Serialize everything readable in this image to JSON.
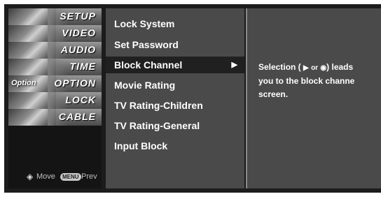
{
  "categories": [
    {
      "label": "SETUP"
    },
    {
      "label": "VIDEO"
    },
    {
      "label": "AUDIO"
    },
    {
      "label": "TIME"
    },
    {
      "label": "OPTION",
      "overlay": "Option"
    },
    {
      "label": "LOCK"
    },
    {
      "label": "CABLE"
    }
  ],
  "hint": {
    "move_label": "Move",
    "menu_key": "MENU",
    "prev_label": "Prev"
  },
  "menu": {
    "items": [
      {
        "label": "Lock System"
      },
      {
        "label": "Set Password"
      },
      {
        "label": "Block Channel",
        "arrow": "▶"
      },
      {
        "label": "Movie Rating"
      },
      {
        "label": "TV Rating-Children"
      },
      {
        "label": "TV Rating-General"
      },
      {
        "label": "Input Block"
      }
    ],
    "selected_index": 2
  },
  "help": {
    "line1_prefix": "Selection (",
    "line1_arrow": "▶",
    "line1_or": "or",
    "line1_ok": "◉",
    "line1_suffix": ") leads",
    "line2": "you to the block channe",
    "line3": "screen."
  }
}
